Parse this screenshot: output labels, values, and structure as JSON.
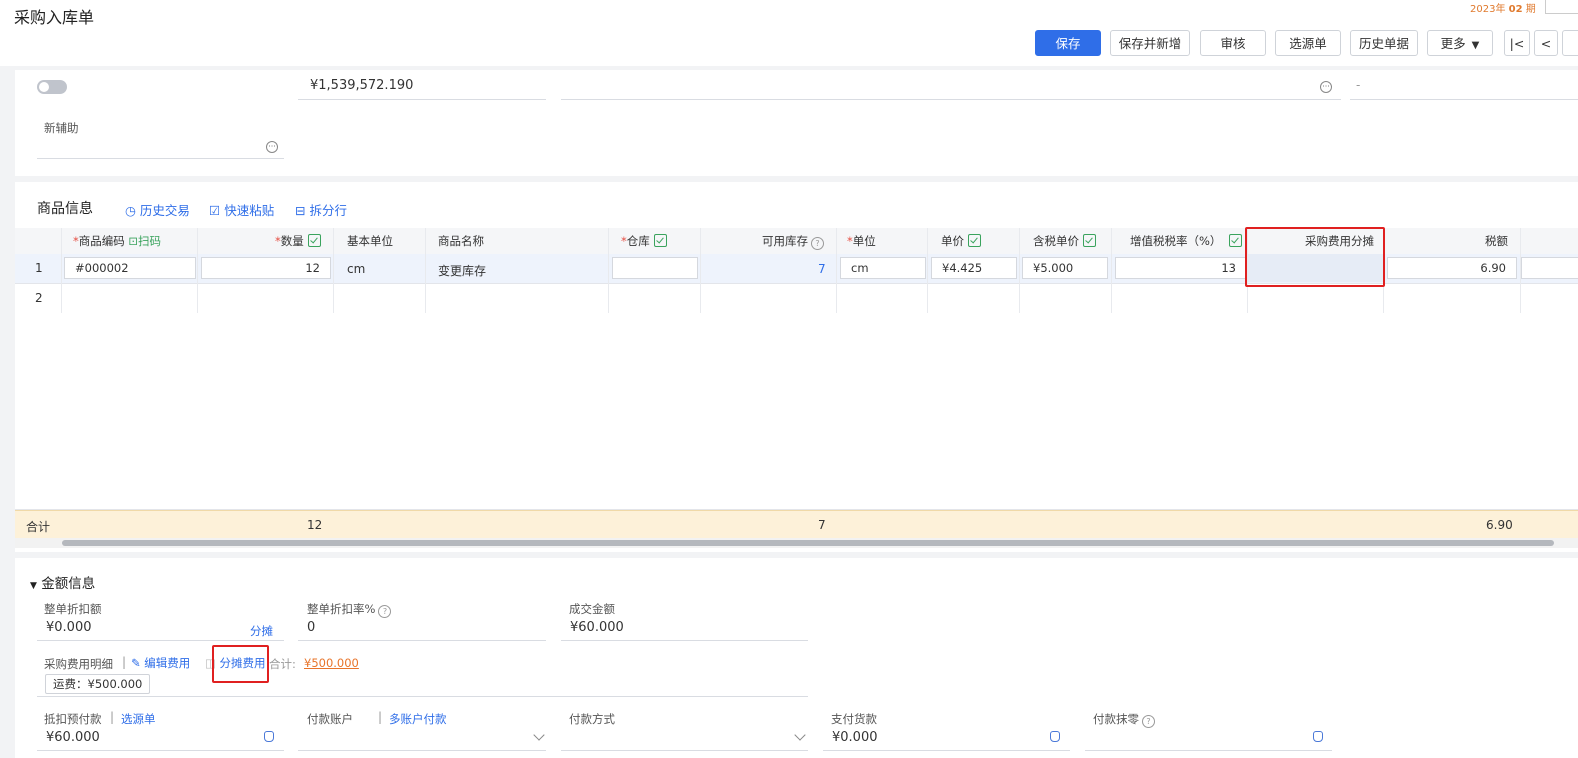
{
  "header": {
    "title": "采购入库单",
    "period": {
      "year": "2023年",
      "num": "02",
      "suffix": "期"
    },
    "buttons": {
      "save": "保存",
      "save_new": "保存并新增",
      "audit": "审核",
      "select_source": "选源单",
      "history": "历史单据",
      "more": "更多"
    }
  },
  "top_form": {
    "amount": "¥1,539,572.190",
    "dash": "-",
    "aux_label": "新辅助"
  },
  "goods": {
    "section_title": "商品信息",
    "history_trade": "历史交易",
    "quick_paste": "快速粘贴",
    "split_row": "拆分行",
    "columns": {
      "code": "商品编码",
      "scan": "扫码",
      "qty": "数量",
      "base_unit": "基本单位",
      "name": "商品名称",
      "warehouse": "仓库",
      "stock": "可用库存",
      "unit": "单位",
      "price": "单价",
      "tax_price": "含税单价",
      "vat": "增值税税率（%）",
      "fee_alloc": "采购费用分摊",
      "tax": "税额"
    },
    "rows": [
      {
        "no": "1",
        "code": "#000002",
        "qty": "12",
        "base_unit": "cm",
        "name": "变更库存",
        "stock": "7",
        "unit": "cm",
        "price": "¥4.425",
        "tax_price": "¥5.000",
        "vat": "13",
        "tax": "6.90"
      },
      {
        "no": "2"
      }
    ],
    "totals": {
      "label": "合计",
      "qty": "12",
      "stock": "7",
      "tax": "6.90"
    }
  },
  "amount_info": {
    "title": "金额信息",
    "discount_label": "整单折扣额",
    "discount_value": "¥0.000",
    "allocate_link": "分摊",
    "discount_rate_label": "整单折扣率%",
    "discount_rate_value": "0",
    "deal_amount_label": "成交金额",
    "deal_amount_value": "¥60.000",
    "fee_detail_label": "采购费用明细",
    "edit_fee": "编辑费用",
    "allocate_fee": "分摊费用",
    "sum_label": "合计:",
    "sum_value": "¥500.000",
    "fee_tag": "运费：¥500.000",
    "prepay_label": "抵扣预付款",
    "select_source": "选源单",
    "prepay_value": "¥60.000",
    "pay_account_label": "付款账户",
    "multi_account": "多账户付款",
    "pay_method_label": "付款方式",
    "pay_goods_label": "支付货款",
    "pay_goods_value": "¥0.000",
    "pay_round_label": "付款抹零"
  }
}
